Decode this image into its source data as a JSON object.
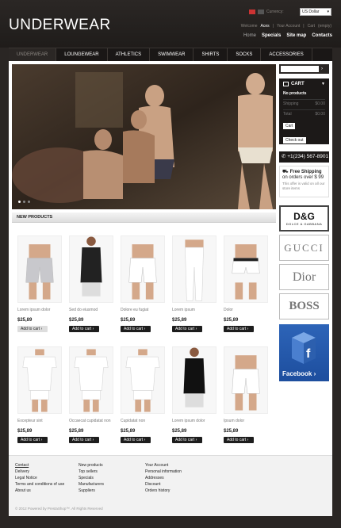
{
  "header": {
    "logo": "UNDERWEAR",
    "currency_label": "Currency:",
    "currency_value": "US Dollar",
    "welcome_prefix": "Welcome",
    "welcome_name": "Aces",
    "your_account": "Your Account",
    "cart_label": "Cart",
    "cart_value": "(empty)",
    "topnav": [
      {
        "label": "Home",
        "dim": true
      },
      {
        "label": "Specials",
        "dim": false
      },
      {
        "label": "Site map",
        "dim": false
      },
      {
        "label": "Contacts",
        "dim": false
      }
    ]
  },
  "menu": [
    "UNDERWEAR",
    "LOUNGEWEAR",
    "ATHLETICS",
    "SWIMWEAR",
    "SHIRTS",
    "SOCKS",
    "ACCESSORIES"
  ],
  "new_products_title": "NEW PRODUCTS",
  "add_to_cart": "Add to cart",
  "products": [
    {
      "name": "Lorem ipsum dolor",
      "price": "$25,89",
      "light": true
    },
    {
      "name": "Sed do eiusmod",
      "price": "$25,89",
      "light": false
    },
    {
      "name": "Dolore eu fugiat",
      "price": "$25,89",
      "light": false
    },
    {
      "name": "Lorem ipsum",
      "price": "$25,89",
      "light": false
    },
    {
      "name": "Dolor",
      "price": "$25,89",
      "light": false
    },
    {
      "name": "Excepteur sint",
      "price": "$25,89",
      "light": false
    },
    {
      "name": "Occaecat cupidatat non",
      "price": "$25,89",
      "light": false
    },
    {
      "name": "Cupidatat non",
      "price": "$25,89",
      "light": false
    },
    {
      "name": "Lorem ipsum dolor",
      "price": "$25,89",
      "light": false
    },
    {
      "name": "Ipsum dolor",
      "price": "$25,89",
      "light": false
    }
  ],
  "sidebar": {
    "cart_title": "CART",
    "no_products": "No products",
    "shipping_label": "Shipping",
    "shipping_value": "$0.00",
    "total_label": "Total",
    "total_value": "$0.00",
    "cart_btn": "Cart",
    "checkout_btn": "Check out",
    "phone": "+1(234) 567-8901",
    "free_shipping_a": "Free Shipping",
    "free_shipping_b": "on orders over $ 99",
    "free_shipping_note": "This offer is valid on all our store items",
    "brands": [
      "D&G",
      "GUCCI",
      "Dior",
      "BOSS"
    ],
    "dg_small": "DOLCE & GABBANA",
    "facebook": "Facebook ›"
  },
  "footer": {
    "col1": [
      "Contact",
      "Delivery",
      "Legal Notice",
      "Terms and conditions of use",
      "About us"
    ],
    "col2": [
      "New products",
      "Top sellers",
      "Specials",
      "Manufacturers",
      "Suppliers"
    ],
    "col3": [
      "Your Account",
      "Personal information",
      "Addresses",
      "Discount",
      "Orders history"
    ],
    "copyright": "© 2012 Powered by PrestaShop™. All Rights Reserved"
  }
}
